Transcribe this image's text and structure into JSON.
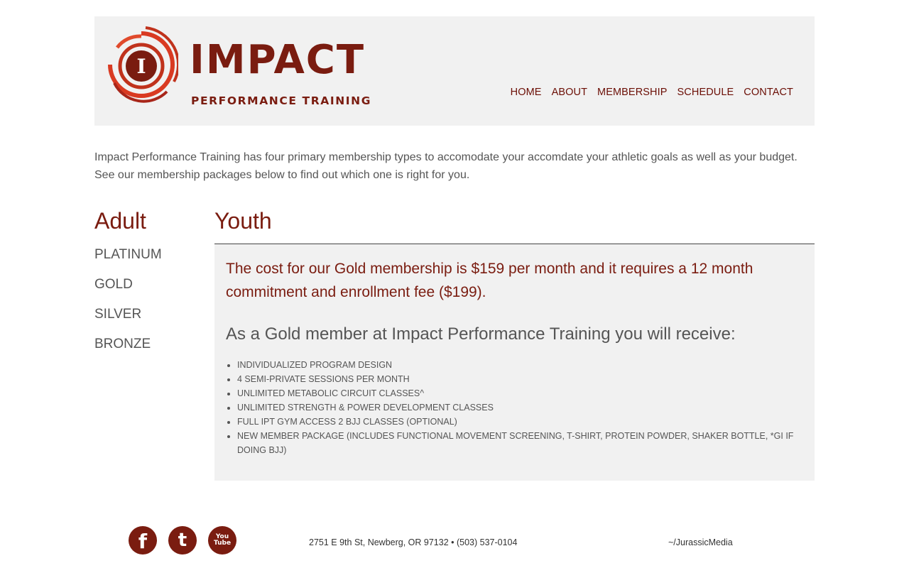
{
  "brand": {
    "name": "IMPACT",
    "tagline": "PERFORMANCE TRAINING",
    "mark_letter": "I",
    "color": "#7a1c10",
    "accent": "#d93a22"
  },
  "nav": {
    "items": [
      "HOME",
      "ABOUT",
      "MEMBERSHIP",
      "SCHEDULE",
      "CONTACT"
    ]
  },
  "intro": {
    "line1": "Impact Performance Training has four primary membership types to accomodate your accomdate your athletic goals as well as your budget.",
    "line2": "See our membership packages below to find out which one is right for you."
  },
  "tabs": {
    "adult": "Adult",
    "youth": "Youth"
  },
  "tiers": [
    "PLATINUM",
    "GOLD",
    "SILVER",
    "BRONZE"
  ],
  "panel": {
    "cost_text": "The cost for our Gold membership is $159 per month and it requires a 12 month commitment and enrollment fee ($199).",
    "benefits_title": "As a Gold member at Impact Performance Training you will receive:",
    "benefits": [
      "INDIVIDUALIZED PROGRAM DESIGN",
      "4 SEMI-PRIVATE SESSIONS PER MONTH",
      "UNLIMITED METABOLIC CIRCUIT CLASSES^",
      "UNLIMITED STRENGTH & POWER DEVELOPMENT CLASSES",
      "FULL IPT GYM ACCESS 2 BJJ CLASSES (OPTIONAL)",
      "NEW MEMBER PACKAGE (INCLUDES FUNCTIONAL MOVEMENT SCREENING, T-SHIRT, PROTEIN POWDER, SHAKER BOTTLE, *GI IF DOING BJJ)"
    ]
  },
  "footer": {
    "social": [
      {
        "icon": "facebook-icon",
        "glyph": "f"
      },
      {
        "icon": "twitter-icon",
        "glyph": "t"
      },
      {
        "icon": "youtube-icon",
        "glyph": "You Tube"
      }
    ],
    "address": "2751 E 9th St, Newberg, OR 97132 • (503) 537-0104",
    "credit": "~/JurassicMedia"
  }
}
